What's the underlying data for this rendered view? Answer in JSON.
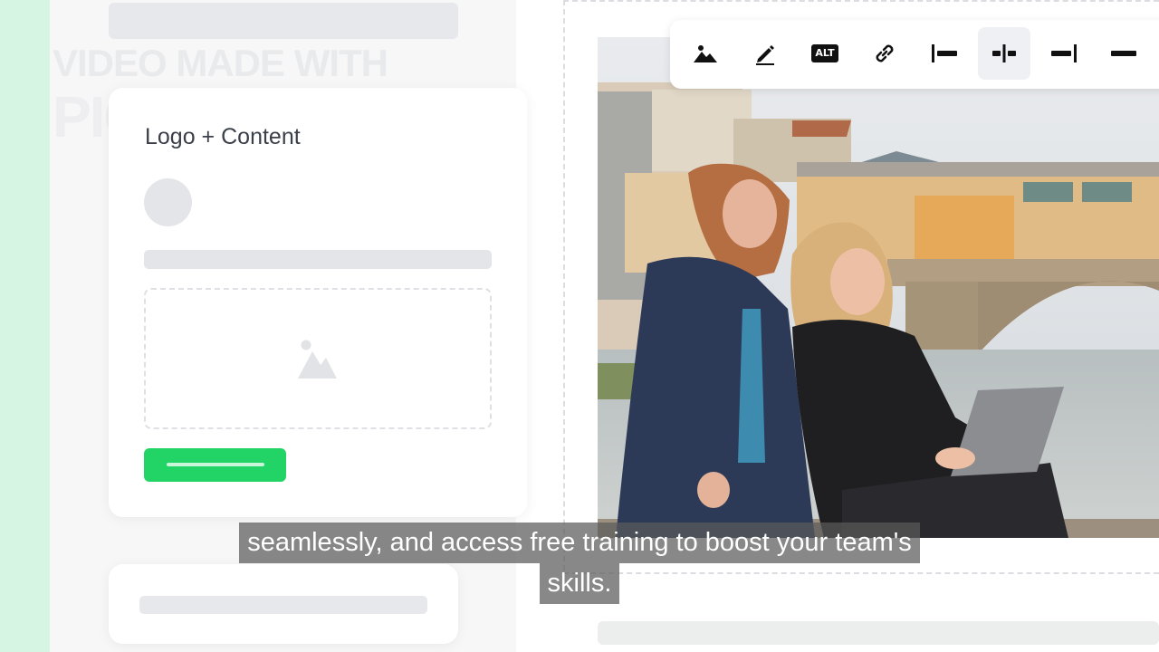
{
  "watermark": {
    "line1": "VIDEO MADE WITH",
    "line2": "PICTORY AI"
  },
  "card": {
    "title": "Logo + Content"
  },
  "toolbar": {
    "tools": [
      {
        "icon": "image-icon"
      },
      {
        "icon": "pencil-icon"
      },
      {
        "icon": "alt-text-icon",
        "label": "ALT"
      },
      {
        "icon": "link-icon"
      },
      {
        "icon": "align-left-icon"
      },
      {
        "icon": "align-center-icon",
        "active": true
      },
      {
        "icon": "align-right-icon"
      },
      {
        "icon": "full-width-icon"
      }
    ]
  },
  "caption": {
    "line1": "seamlessly, and access free training to boost your team's",
    "line2": "skills."
  },
  "colors": {
    "accent_green": "#22d466",
    "left_strip": "#d6f5e3"
  }
}
